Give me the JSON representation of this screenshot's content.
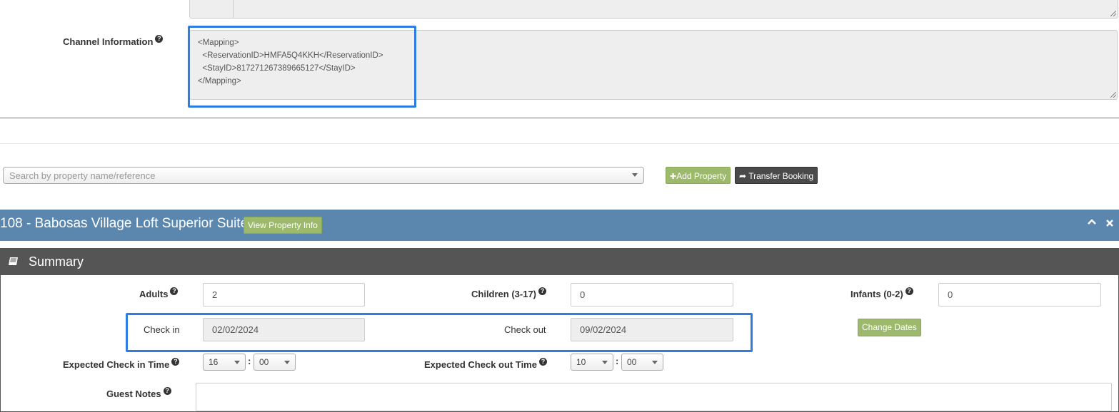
{
  "channel": {
    "label": "Channel Information",
    "xml": "<Mapping>\n  <ReservationID>HMFA5Q4KKH</ReservationID>\n  <StayID>817271267389665127</StayID>\n</Mapping>"
  },
  "search": {
    "placeholder": "Search by property name/reference"
  },
  "buttons": {
    "add_property": "Add Property",
    "transfer_booking": "Transfer Booking",
    "view_property_info": "View Property Info",
    "change_dates": "Change Dates"
  },
  "property": {
    "title": "108 - Babosas Village Loft Superior Suite"
  },
  "summary": {
    "title": "Summary",
    "adults_label": "Adults",
    "adults_value": "2",
    "children_label": "Children (3-17)",
    "children_value": "0",
    "infants_label": "Infants (0-2)",
    "infants_value": "0",
    "checkin_label": "Check in",
    "checkin_value": "02/02/2024",
    "checkout_label": "Check out",
    "checkout_value": "09/02/2024",
    "exp_checkin_label": "Expected Check in Time",
    "exp_checkin_hour": "16",
    "exp_checkin_min": "00",
    "exp_checkout_label": "Expected Check out Time",
    "exp_checkout_hour": "10",
    "exp_checkout_min": "00",
    "time_separator": ":",
    "guest_notes_label": "Guest Notes"
  },
  "icons": {
    "help": "?",
    "plus": "✚",
    "share": "➦",
    "collapse": "⌃",
    "close": "✖"
  },
  "colors": {
    "property_bar": "#5b87ae",
    "summary_bar": "#555555",
    "green_button": "#9dba6c",
    "highlight": "#2f7de1"
  }
}
